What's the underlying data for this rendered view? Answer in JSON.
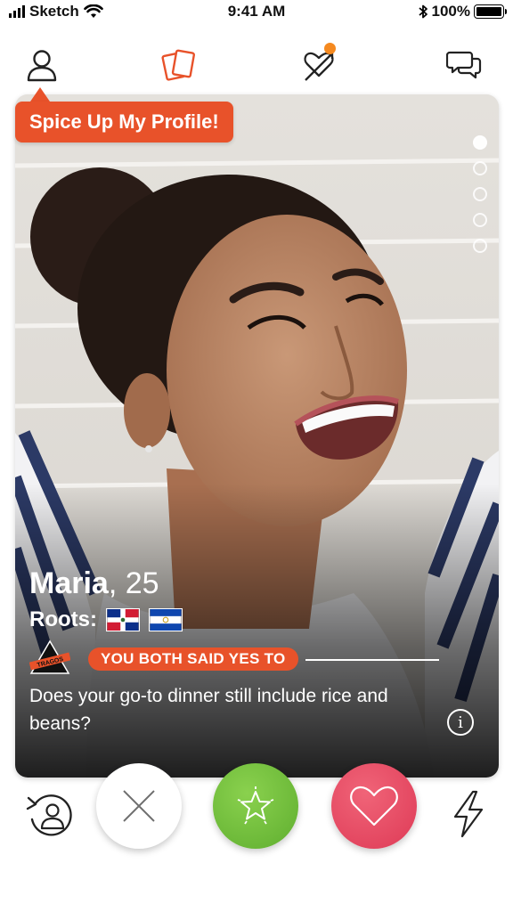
{
  "status_bar": {
    "carrier": "Sketch",
    "time": "9:41 AM",
    "battery_percent": "100%"
  },
  "top_nav": {
    "icons": [
      "profile-icon",
      "cards-icon",
      "matches-heart-icon",
      "chat-icon"
    ],
    "notification_color": "#f5891f",
    "active_color": "#e8522a"
  },
  "callout": {
    "label": "Spice Up My Profile!"
  },
  "card": {
    "name": "Maria",
    "age": ", 25",
    "roots_label": "Roots:",
    "flags": [
      "dominican-republic-flag",
      "el-salvador-flag"
    ],
    "badge_text": "TRAGOS",
    "agreement_label": "YOU BOTH SAID YES TO",
    "question": "Does your go-to dinner still include rice and beans?",
    "info_symbol": "i",
    "photo_count": 5,
    "active_photo": 1
  },
  "actions": {
    "rewind": "rewind-icon",
    "nope": "close-icon",
    "super": "star-icon",
    "like": "heart-icon",
    "boost": "lightning-icon"
  },
  "colors": {
    "accent": "#e8522a",
    "green": "#6dbd3a",
    "pink": "#e34660"
  }
}
